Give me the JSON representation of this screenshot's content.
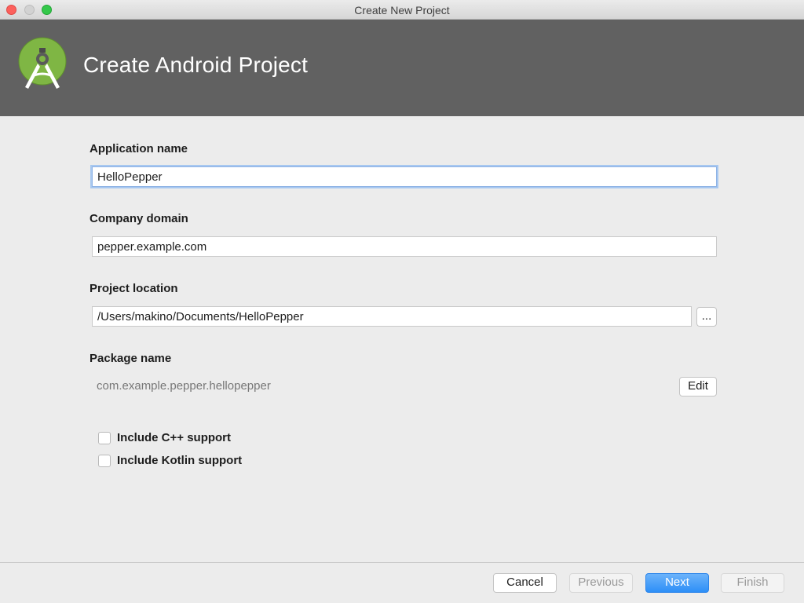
{
  "window": {
    "title": "Create New Project"
  },
  "header": {
    "title": "Create Android Project",
    "logo_icon": "android-studio-icon"
  },
  "form": {
    "app_name": {
      "label": "Application name",
      "value": "HelloPepper"
    },
    "company_domain": {
      "label": "Company domain",
      "value": "pepper.example.com"
    },
    "project_location": {
      "label": "Project location",
      "value": "/Users/makino/Documents/HelloPepper",
      "browse_label": "..."
    },
    "package_name": {
      "label": "Package name",
      "value": "com.example.pepper.hellopepper",
      "edit_label": "Edit"
    },
    "options": [
      {
        "label": "Include C++ support",
        "checked": false
      },
      {
        "label": "Include Kotlin support",
        "checked": false
      }
    ]
  },
  "footer": {
    "cancel_label": "Cancel",
    "previous_label": "Previous",
    "next_label": "Next",
    "finish_label": "Finish"
  },
  "colors": {
    "header_bg": "#616161",
    "primary_button": "#2d8ff7",
    "focus_ring": "#a8c8f0"
  }
}
